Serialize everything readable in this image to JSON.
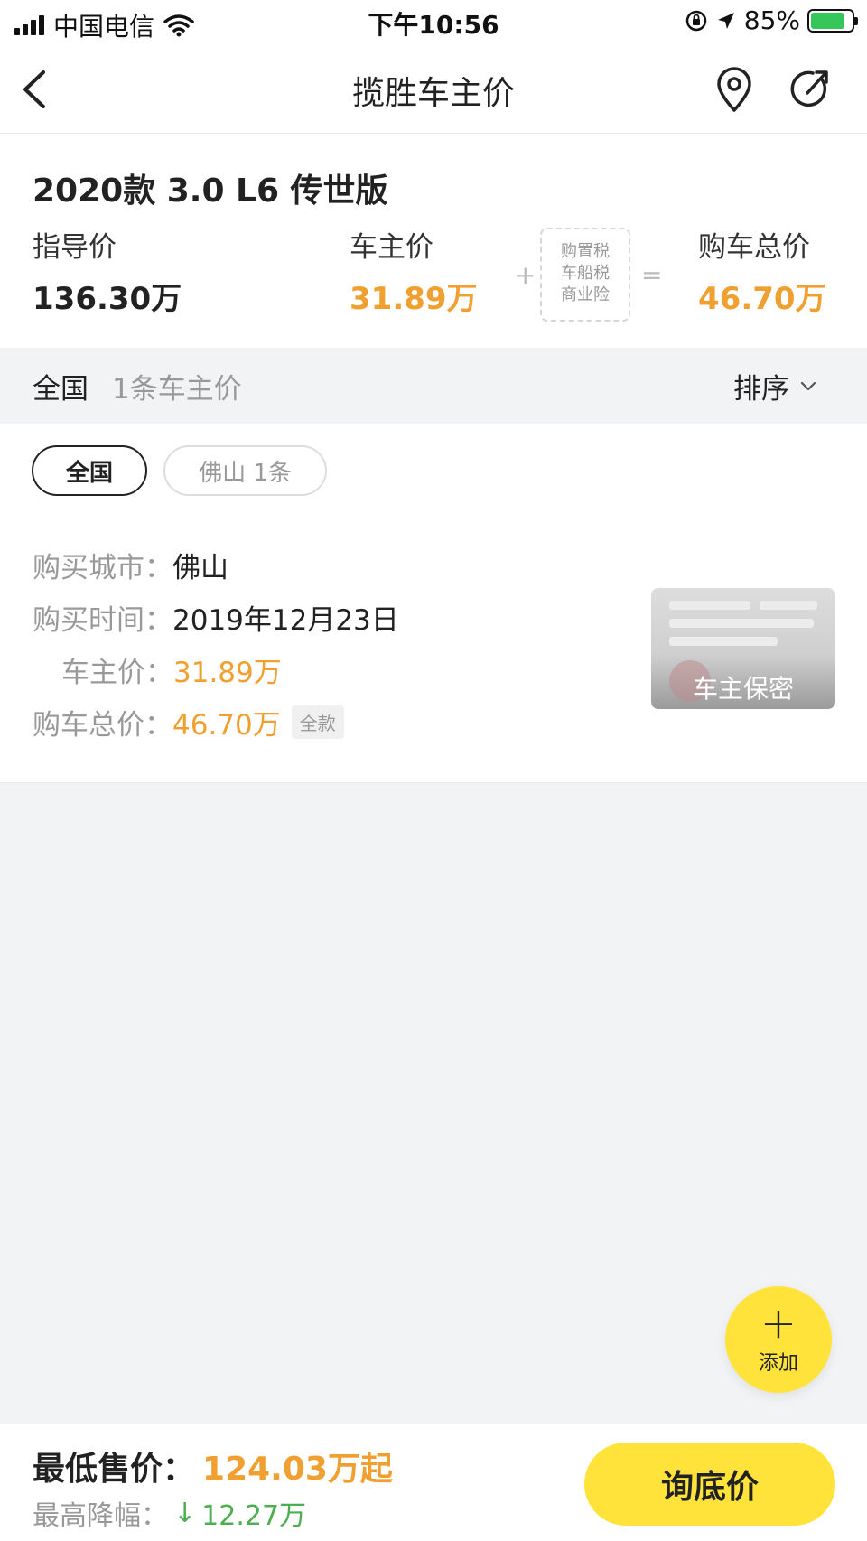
{
  "status_bar": {
    "carrier": "中国电信",
    "time": "下午10:56",
    "battery_pct": "85%"
  },
  "nav": {
    "title": "揽胜车主价",
    "back_icon": "chevron-left-icon",
    "location_icon": "location-pin-icon",
    "share_icon": "share-icon"
  },
  "summary": {
    "model": "2020款 3.0 L6 传世版",
    "guide_label": "指导价",
    "guide_value": "136.30万",
    "owner_label": "车主价",
    "owner_value": "31.89万",
    "plus": "+",
    "taxes": [
      "购置税",
      "车船税",
      "商业险"
    ],
    "equals": "=",
    "total_label": "购车总价",
    "total_value": "46.70万"
  },
  "filter": {
    "region": "全国",
    "count": "1条车主价",
    "sort_label": "排序"
  },
  "chips": {
    "all": "全国",
    "city": "佛山 1条"
  },
  "record": {
    "city_label": "购买城市：",
    "city_value": "佛山",
    "date_label": "购买时间：",
    "date_value": "2019年12月23日",
    "owner_price_label": "车主价：",
    "owner_price_value": "31.89万",
    "total_label": "购车总价：",
    "total_value": "46.70万",
    "payment_tag": "全款",
    "thumb_label": "车主保密"
  },
  "fab": {
    "plus": "+",
    "label": "添加"
  },
  "bottom": {
    "lowest_label": "最低售价：",
    "lowest_value": "124.03万起",
    "drop_label": "最高降幅：",
    "drop_arrow": "↓",
    "drop_value": "12.27万",
    "ask_button": "询底价"
  },
  "colors": {
    "accent_orange": "#f0a030",
    "accent_yellow": "#ffe33a",
    "drop_green": "#4caf50"
  }
}
